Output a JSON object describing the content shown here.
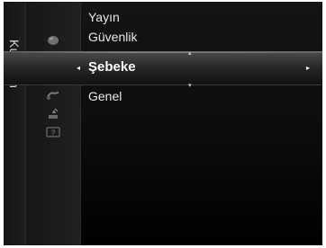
{
  "panel": {
    "title": "Kurulum"
  },
  "menu": {
    "items": [
      {
        "label": "Yayın"
      },
      {
        "label": "Güvenlik"
      },
      {
        "label": "Şebeke"
      },
      {
        "label": "Genel"
      }
    ],
    "selected_index": 2
  },
  "icons": [
    {
      "name": "picture-icon"
    },
    {
      "name": "setup-gear-icon"
    },
    {
      "name": "input-icon"
    },
    {
      "name": "application-icon"
    },
    {
      "name": "support-help-icon"
    }
  ],
  "colors": {
    "background": "#0b0b0b",
    "text": "#e8e8e8",
    "highlight_text": "#ffffff"
  }
}
